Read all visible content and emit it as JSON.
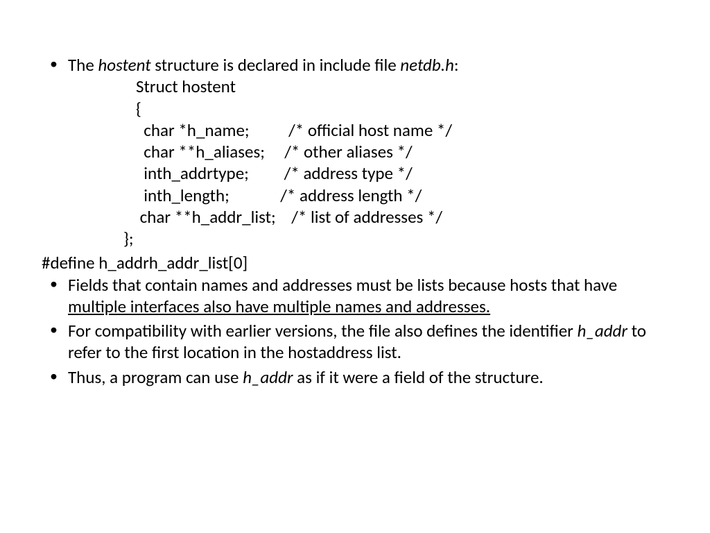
{
  "bullet1": {
    "pre": "The ",
    "em1": "hostent",
    "mid": " structure is declared in include file ",
    "em2": "netdb.h",
    "post": ":"
  },
  "struct": {
    "l1": "Struct hostent",
    "l2": "{",
    "l3": "  char *h_name;          /* official host name */",
    "l4": "  char **h_aliases;     /* other aliases */",
    "l5": "  inth_addrtype;         /* address type */",
    "l6": "  inth_length;             /* address length */",
    "l7": " char **h_addr_list;    /* list of addresses */",
    "close": "};"
  },
  "define": "#define h_addrh_addr_list[0]",
  "bullet2": {
    "pre": "Fields that contain names and addresses must be lists because hosts that have ",
    "und": "multiple interfaces also have multiple names and addresses."
  },
  "bullet3": {
    "pre": "For compatibility with earlier versions, the file also defines the identifier ",
    "em": "h_addr",
    "post": " to refer to the first location in the hostaddress list."
  },
  "bullet4": {
    "pre": "Thus, a program can use ",
    "em": "h_addr",
    "post": " as if it were a field of the structure."
  }
}
